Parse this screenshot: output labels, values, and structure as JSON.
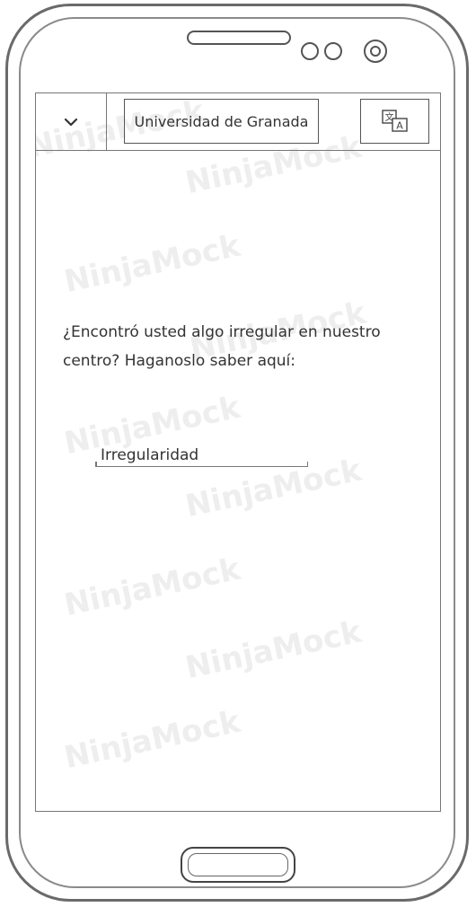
{
  "watermark": {
    "text": "NinjaMock"
  },
  "appbar": {
    "menu_icon": "chevron-down-icon",
    "title": "Universidad de Granada",
    "translate_icon": "translate-icon"
  },
  "content": {
    "prompt": "¿Encontró usted algo irregular en nuestro centro? Haganoslo saber aquí:",
    "field_value": "Irregularidad"
  }
}
